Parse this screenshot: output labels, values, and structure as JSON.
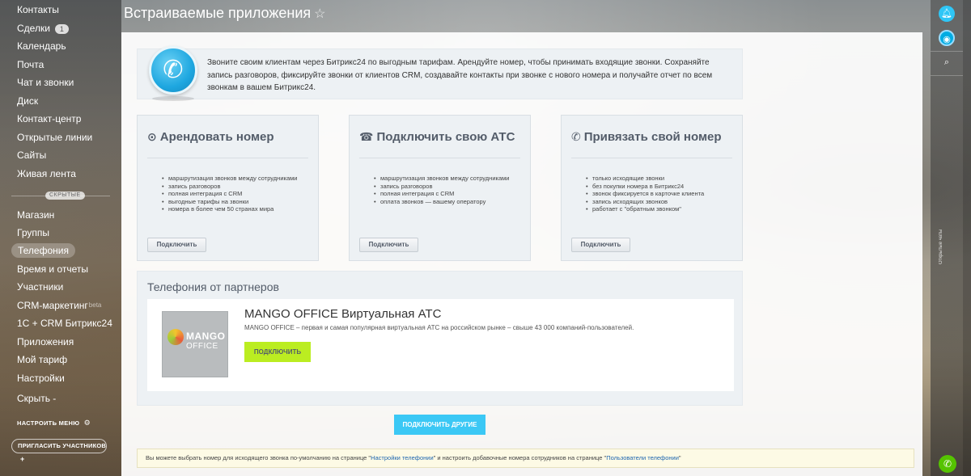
{
  "page": {
    "title": "Встраиваемые приложения",
    "star_icon": "star-icon"
  },
  "sidebar": {
    "items": [
      {
        "label": "Контакты"
      },
      {
        "label": "Сделки",
        "counter": "1"
      },
      {
        "label": "Календарь"
      },
      {
        "label": "Почта"
      },
      {
        "label": "Чат и звонки"
      },
      {
        "label": "Диск"
      },
      {
        "label": "Контакт-центр"
      },
      {
        "label": "Открытые линии"
      },
      {
        "label": "Сайты"
      },
      {
        "label": "Живая лента"
      }
    ],
    "hidden_label": "СКРЫТЫЕ",
    "hidden_items": [
      {
        "label": "Магазин"
      },
      {
        "label": "Группы"
      },
      {
        "label": "Телефония",
        "active": true
      },
      {
        "label": "Время и отчеты"
      },
      {
        "label": "Участники"
      },
      {
        "label": "CRM-маркетинг",
        "badge": "beta"
      },
      {
        "label": "1С + CRM Битрикс24"
      },
      {
        "label": "Приложения"
      },
      {
        "label": "Мой тариф"
      },
      {
        "label": "Настройки"
      },
      {
        "label": "Скрыть -"
      }
    ],
    "config_menu": "НАСТРОИТЬ МЕНЮ",
    "config_icon": "gear-icon",
    "invite": "ПРИГЛАСИТЬ УЧАСТНИКОВ",
    "invite_icon": "plus-icon"
  },
  "banner": {
    "icon": "phone-icon",
    "text": "Звоните своим клиентам через Битрикс24 по выгодным тарифам. Арендуйте номер, чтобы принимать входящие звонки. Сохраняйте запись разговоров, фиксируйте звонки от клиентов CRM, создавайте контакты при звонке с нового номера и получайте отчет по всем звонкам в вашем Битрикс24."
  },
  "cards": [
    {
      "title": "Арендовать номер",
      "icon": "rent-number-icon",
      "features": [
        "маршрутизация звонков между сотрудниками",
        "запись разговоров",
        "полная интеграция с CRM",
        "выгодные тарифы на звонки",
        "номера в более чем 50 странах мира"
      ],
      "button": "Подключить"
    },
    {
      "title": "Подключить свою АТС",
      "icon": "pbx-icon",
      "features": [
        "маршрутизация звонков между сотрудниками",
        "запись разговоров",
        "полная интеграция с CRM",
        "оплата звонков — вашему оператору"
      ],
      "button": "Подключить"
    },
    {
      "title": "Привязать свой номер",
      "icon": "link-number-icon",
      "features": [
        "только исходящие звонки",
        "без покупки номера в Битрикс24",
        "звонок фиксируется в карточке клиента",
        "запись исходящих звонков",
        "работает с \"обратным звонком\""
      ],
      "button": "Подключить"
    }
  ],
  "partners": {
    "title": "Телефония от партнеров",
    "items": [
      {
        "logo_line1": "MANGO",
        "logo_line2": "OFFICE",
        "name": "MANGO OFFICE Виртуальная АТС",
        "description": "MANGO OFFICE – первая и самая популярная виртуальная АТС на российском рынке – свыше 43 000 компаний-пользователей.",
        "button": "ПОДКЛЮЧИТЬ"
      }
    ],
    "connect_others": "ПОДКЛЮЧИТЬ ДРУГИЕ"
  },
  "footer": {
    "part1": "Вы можете выбрать номер для исходящего звонка по-умолчанию на странице \"",
    "link1": "Настройки телефонии",
    "part2": "\" и настроить добавочные номера сотрудников на странице \"",
    "link2": "Пользователи телефонии",
    "part3": "\""
  },
  "right_panel": {
    "buttons": [
      "bell-icon",
      "chat-icon",
      "search-icon"
    ],
    "open_chats": "Открытые чаты",
    "call_icon": "phone-call-icon"
  },
  "colors": {
    "accent": "#3bc8f5",
    "partner_button": "#bbed21",
    "call_button": "#55c300"
  }
}
